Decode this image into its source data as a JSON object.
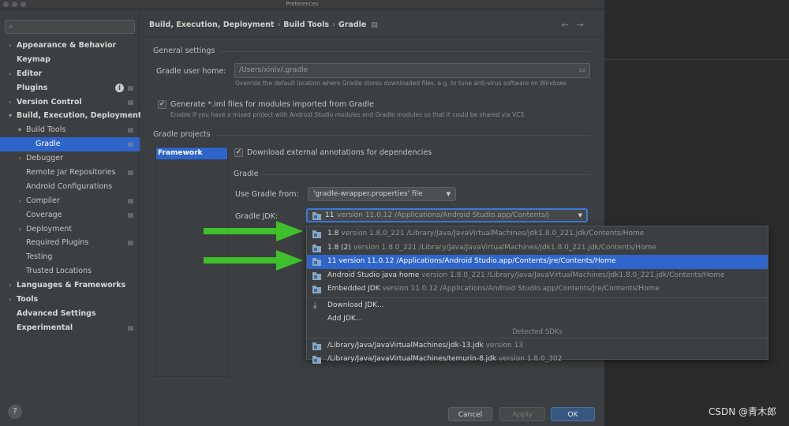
{
  "window": {
    "title": "Preferences"
  },
  "sidebar": {
    "search_placeholder": "",
    "items": [
      {
        "label": "Appearance & Behavior",
        "level": 0,
        "arrow": "right",
        "bold": true,
        "badge": ""
      },
      {
        "label": "Keymap",
        "level": 0,
        "arrow": "",
        "bold": true,
        "badge": ""
      },
      {
        "label": "Editor",
        "level": 0,
        "arrow": "right",
        "bold": true,
        "badge": ""
      },
      {
        "label": "Plugins",
        "level": 0,
        "arrow": "",
        "bold": true,
        "badge": "settings",
        "info": true
      },
      {
        "label": "Version Control",
        "level": 0,
        "arrow": "right",
        "bold": true,
        "badge": "settings"
      },
      {
        "label": "Build, Execution, Deployment",
        "level": 0,
        "arrow": "down",
        "bold": true,
        "badge": ""
      },
      {
        "label": "Build Tools",
        "level": 1,
        "arrow": "down",
        "bold": false,
        "badge": "settings"
      },
      {
        "label": "Gradle",
        "level": 2,
        "arrow": "",
        "bold": false,
        "badge": "settings",
        "selected": true
      },
      {
        "label": "Debugger",
        "level": 1,
        "arrow": "right",
        "bold": false,
        "badge": ""
      },
      {
        "label": "Remote Jar Repositories",
        "level": 1,
        "arrow": "",
        "bold": false,
        "badge": "settings"
      },
      {
        "label": "Android Configurations",
        "level": 1,
        "arrow": "",
        "bold": false,
        "badge": ""
      },
      {
        "label": "Compiler",
        "level": 1,
        "arrow": "right",
        "bold": false,
        "badge": "settings"
      },
      {
        "label": "Coverage",
        "level": 1,
        "arrow": "",
        "bold": false,
        "badge": "settings"
      },
      {
        "label": "Deployment",
        "level": 1,
        "arrow": "right",
        "bold": false,
        "badge": ""
      },
      {
        "label": "Required Plugins",
        "level": 1,
        "arrow": "",
        "bold": false,
        "badge": "settings"
      },
      {
        "label": "Testing",
        "level": 1,
        "arrow": "",
        "bold": false,
        "badge": ""
      },
      {
        "label": "Trusted Locations",
        "level": 1,
        "arrow": "",
        "bold": false,
        "badge": ""
      },
      {
        "label": "Languages & Frameworks",
        "level": 0,
        "arrow": "right",
        "bold": true,
        "badge": ""
      },
      {
        "label": "Tools",
        "level": 0,
        "arrow": "right",
        "bold": true,
        "badge": ""
      },
      {
        "label": "Advanced Settings",
        "level": 0,
        "arrow": "",
        "bold": true,
        "badge": ""
      },
      {
        "label": "Experimental",
        "level": 0,
        "arrow": "",
        "bold": true,
        "badge": "settings"
      }
    ],
    "help_label": "?"
  },
  "breadcrumb": {
    "items": [
      "Build, Execution, Deployment",
      "Build Tools",
      "Gradle"
    ],
    "separator": "›",
    "back_icon": "arrow-left-icon",
    "forward_icon": "arrow-right-icon"
  },
  "general": {
    "heading": "General settings",
    "user_home_label": "Gradle user home:",
    "user_home_value": "/Users/xinlv/.gradle",
    "user_home_hint": "Override the default location where Gradle stores downloaded files, e.g. to tune anti-virus software on Windows",
    "iml_label": "Generate *.iml files for modules imported from Gradle",
    "iml_checked": true,
    "iml_hint": "Enable if you have a mixed project with Android Studio modules and Gradle modules so that it could be shared via VCS"
  },
  "projects": {
    "heading": "Gradle projects",
    "list": [
      "Framework"
    ],
    "download_annotations_label": "Download external annotations for dependencies",
    "download_annotations_checked": true,
    "gradle_heading": "Gradle",
    "use_gradle_from_label": "Use Gradle from:",
    "use_gradle_from_value": "'gradle-wrapper.properties' file",
    "jdk_label": "Gradle JDK:",
    "jdk_value_name": "11",
    "jdk_value_detail": "version 11.0.12 /Applications/Android Studio.app/Contents/j"
  },
  "dropdown": {
    "items": [
      {
        "name": "1.8",
        "detail": "version 1.8.0_221 /Library/Java/JavaVirtualMachines/jdk1.8.0_221.jdk/Contents/Home",
        "icon": "jdk-folder-icon"
      },
      {
        "name": "1.8 (2)",
        "detail": "version 1.8.0_221 /Library/Java/JavaVirtualMachines/jdk1.8.0_221.jdk/Contents/Home",
        "icon": "jdk-folder-icon"
      },
      {
        "name": "11 version 11.0.12 /Applications/Android Studio.app/Contents/jre/Contents/Home",
        "detail": "",
        "icon": "jdk-folder-icon",
        "highlighted": true
      },
      {
        "name": "Android Studio java home",
        "detail": "version 1.8.0_221 /Library/Java/JavaVirtualMachines/jdk1.8.0_221.jdk/Contents/Home",
        "icon": "jdk-folder-icon"
      },
      {
        "name": "Embedded JDK",
        "detail": "version 11.0.12 /Applications/Android Studio.app/Contents/jre/Contents/Home",
        "icon": "jdk-folder-icon"
      }
    ],
    "actions": [
      {
        "label": "Download JDK...",
        "icon": "download-icon"
      },
      {
        "label": "Add JDK...",
        "icon": ""
      }
    ],
    "detected_label": "Detected SDKs",
    "detected": [
      {
        "name": "/Library/Java/JavaVirtualMachines/jdk-13.jdk",
        "detail": "version 13",
        "icon": "jdk-folder-icon"
      },
      {
        "name": "/Library/Java/JavaVirtualMachines/temurin-8.jdk",
        "detail": "version 1.8.0_302",
        "icon": "jdk-folder-icon"
      }
    ]
  },
  "buttons": {
    "cancel": "Cancel",
    "apply": "Apply",
    "ok": "OK"
  },
  "colors": {
    "selection": "#2f65ca",
    "annotation_arrow": "#3fbf2b",
    "background": "#3c3f41"
  },
  "watermark": "CSDN @青木郎"
}
